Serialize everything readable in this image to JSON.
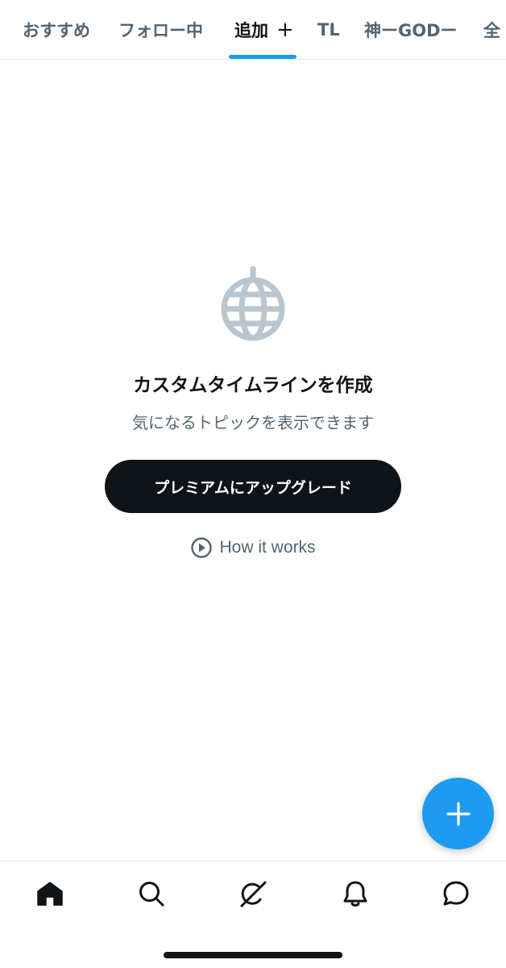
{
  "tabs": [
    {
      "label": "おすすめ",
      "active": false
    },
    {
      "label": "フォロー中",
      "active": false
    },
    {
      "label": "追加",
      "active": true,
      "suffix": "+"
    },
    {
      "label": "TL",
      "active": false
    },
    {
      "label": "神ーGODー",
      "active": false
    },
    {
      "label": "全",
      "active": false
    }
  ],
  "empty_state": {
    "icon": "globe-icon",
    "title": "カスタムタイムラインを作成",
    "subtitle": "気になるトピックを表示できます",
    "upgrade_label": "プレミアムにアップグレード",
    "how_label": "How it works"
  },
  "fab": {
    "icon": "plus-icon"
  },
  "bottom_nav": [
    {
      "icon": "home-icon",
      "active": true
    },
    {
      "icon": "search-icon",
      "active": false
    },
    {
      "icon": "grok-icon",
      "active": false
    },
    {
      "icon": "bell-icon",
      "active": false
    },
    {
      "icon": "message-icon",
      "active": false
    }
  ],
  "colors": {
    "accent": "#1d9bf0",
    "text_primary": "#0f1419",
    "text_secondary": "#536471",
    "icon_muted": "#b9c6cf",
    "divider": "#e7e9ea"
  }
}
